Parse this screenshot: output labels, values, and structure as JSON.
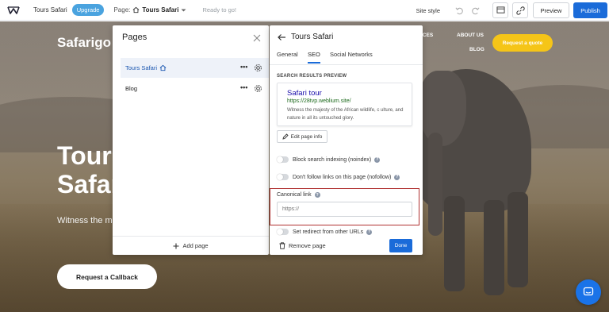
{
  "toolbar": {
    "site_name": "Tours Safari",
    "upgrade_label": "Upgrade",
    "page_prefix": "Page:",
    "page_name": "Tours Safari",
    "status": "Ready to go!",
    "site_style_label": "Site style",
    "preview_label": "Preview",
    "publish_label": "Publish"
  },
  "website": {
    "logo": "Safarigo",
    "nav": [
      "ICES",
      "ABOUT US",
      "BLOG"
    ],
    "quote_button": "Request a quote",
    "hero_title": "Tours Safari",
    "hero_subtitle": "Witness the m",
    "callback_button": "Request a Callback"
  },
  "pages_panel": {
    "title": "Pages",
    "items": [
      {
        "label": "Tours Safari",
        "is_home": true,
        "active": true
      },
      {
        "label": "Blog",
        "is_home": false,
        "active": false
      }
    ],
    "add_page_label": "Add page"
  },
  "settings_panel": {
    "title": "Tours Safari",
    "tabs": [
      {
        "label": "General",
        "active": false
      },
      {
        "label": "SEO",
        "active": true
      },
      {
        "label": "Social Networks",
        "active": false
      }
    ],
    "section_label": "SEARCH RESULTS PREVIEW",
    "serp": {
      "title": "Safari tour",
      "url": "https://28tvp.weblium.site/",
      "description": "Witness the majesty of the African wildlife, c ulture, and nature in all its untouched glory."
    },
    "edit_info_label": "Edit page info",
    "toggles": [
      {
        "label": "Block search indexing (noindex)",
        "on": false,
        "help": true
      },
      {
        "label": "Don't follow links on this page (nofollow)",
        "on": false,
        "help": true
      },
      {
        "label": "Set redirect from other URLs",
        "on": false,
        "help": true
      }
    ],
    "canonical": {
      "label": "Canonical link",
      "placeholder": "https://",
      "value": ""
    },
    "remove_page_label": "Remove page",
    "done_label": "Done"
  },
  "colors": {
    "accent_blue": "#1a6bd9",
    "upgrade_blue": "#4aa3df",
    "quote_yellow": "#f5c518",
    "highlight_red": "#b03131"
  }
}
